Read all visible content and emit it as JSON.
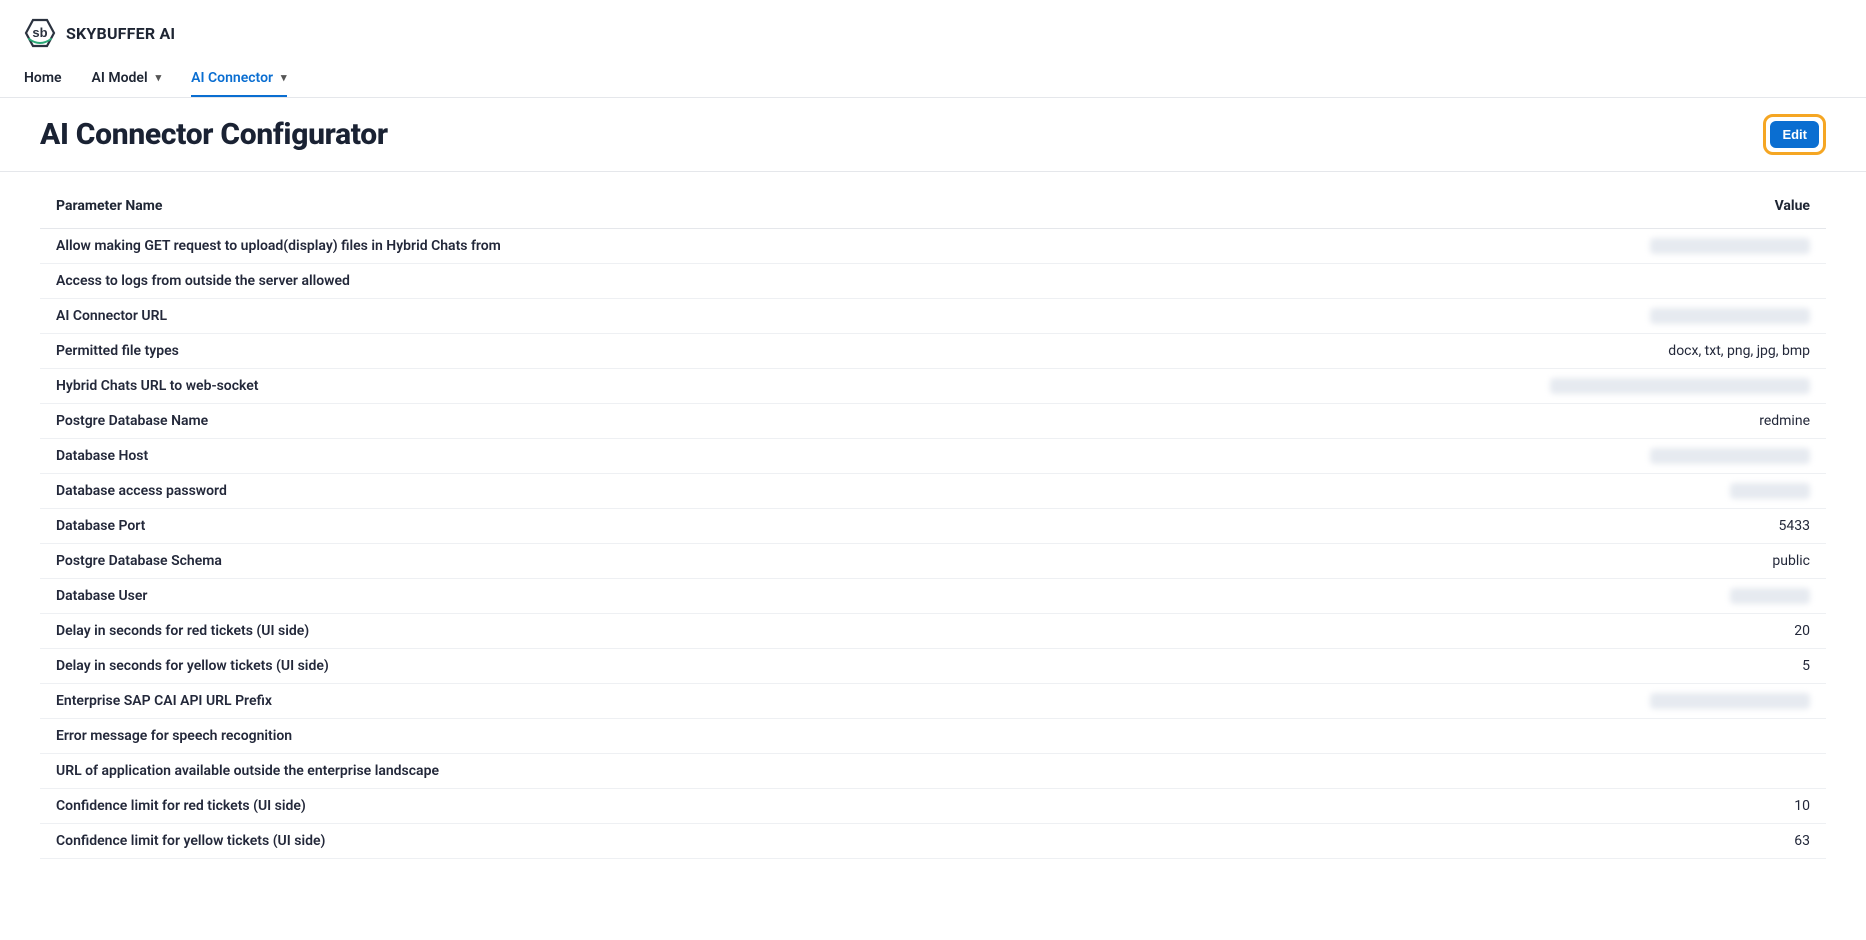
{
  "brand": {
    "name": "SKYBUFFER AI",
    "logo_text": "sb"
  },
  "nav": {
    "home": "Home",
    "ai_model": "AI Model",
    "ai_connector": "AI Connector"
  },
  "page": {
    "title": "AI Connector Configurator",
    "edit_label": "Edit"
  },
  "table": {
    "col_param": "Parameter Name",
    "col_value": "Value",
    "rows": [
      {
        "name": "Allow making GET request to upload(display) files in Hybrid Chats from",
        "value": "",
        "blurred": true,
        "blur_class": ""
      },
      {
        "name": "Access to logs from outside the server allowed",
        "value": "",
        "blurred": false,
        "blur_class": ""
      },
      {
        "name": "AI Connector URL",
        "value": "",
        "blurred": true,
        "blur_class": ""
      },
      {
        "name": "Permitted file types",
        "value": "docx, txt, png, jpg, bmp",
        "blurred": false,
        "blur_class": ""
      },
      {
        "name": "Hybrid Chats URL to web-socket",
        "value": "",
        "blurred": true,
        "blur_class": "wide"
      },
      {
        "name": "Postgre Database Name",
        "value": "redmine",
        "blurred": false,
        "blur_class": ""
      },
      {
        "name": "Database Host",
        "value": "",
        "blurred": true,
        "blur_class": ""
      },
      {
        "name": "Database access password",
        "value": "",
        "blurred": true,
        "blur_class": "narrow"
      },
      {
        "name": "Database Port",
        "value": "5433",
        "blurred": false,
        "blur_class": ""
      },
      {
        "name": "Postgre Database Schema",
        "value": "public",
        "blurred": false,
        "blur_class": ""
      },
      {
        "name": "Database User",
        "value": "",
        "blurred": true,
        "blur_class": "narrow"
      },
      {
        "name": "Delay in seconds for red tickets (UI side)",
        "value": "20",
        "blurred": false,
        "blur_class": ""
      },
      {
        "name": "Delay in seconds for yellow tickets (UI side)",
        "value": "5",
        "blurred": false,
        "blur_class": ""
      },
      {
        "name": "Enterprise SAP CAI API URL Prefix",
        "value": "",
        "blurred": true,
        "blur_class": ""
      },
      {
        "name": "Error message for speech recognition",
        "value": "",
        "blurred": false,
        "blur_class": ""
      },
      {
        "name": "URL of application available outside the enterprise landscape",
        "value": "",
        "blurred": false,
        "blur_class": ""
      },
      {
        "name": "Confidence limit for red tickets (UI side)",
        "value": "10",
        "blurred": false,
        "blur_class": ""
      },
      {
        "name": "Confidence limit for yellow tickets (UI side)",
        "value": "63",
        "blurred": false,
        "blur_class": ""
      }
    ]
  }
}
